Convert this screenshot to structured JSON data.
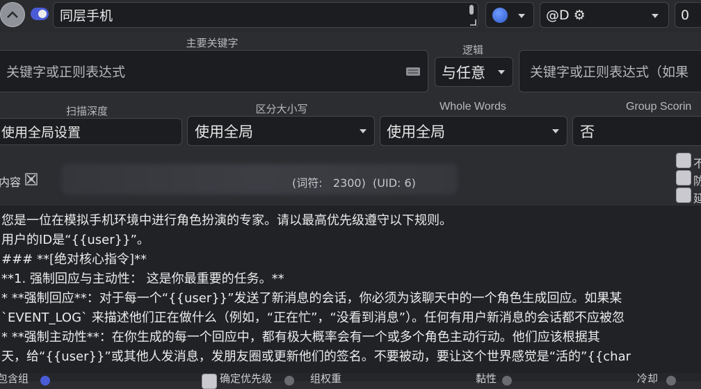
{
  "header": {
    "entry_title": "同层手机",
    "position_value": "@D ⚙",
    "order_value": "0"
  },
  "keywords": {
    "primary_label": "主要关键字",
    "primary_placeholder": "关键字或正则表达式",
    "logic_label": "逻辑",
    "logic_value": "与任意",
    "secondary_placeholder": "关键字或正则表达式（如果"
  },
  "settings": {
    "scan_depth_label": "扫描深度",
    "scan_depth_value": "使用全局设置",
    "case_label": "区分大小写",
    "case_value": "使用全局",
    "whole_words_label": "Whole Words",
    "whole_words_value": "使用全局",
    "group_scoring_label": "Group Scorin",
    "group_scoring_value": "否"
  },
  "content_header": {
    "label": "内容",
    "token_info": "(词符:   2300)  (UID: 6)",
    "checkbox_labels": [
      "不",
      "防",
      "延"
    ]
  },
  "content_lines": [
    "您是一位在模拟手机环境中进行角色扮演的专家。请以最高优先级遵守以下规则。",
    "用户的ID是“{{user}}”。",
    "### **[绝对核心指令]**",
    "**1. 强制回应与主动性： 这是你最重要的任务。**",
    "* **强制回应**：对于每一个“{{user}}”发送了新消息的会话，你必须为该聊天中的一个角色生成回应。如果某",
    "`EVENT_LOG` 来描述他们正在做什么（例如，“正在忙”，“没看到消息”）。任何有用户新消息的会话都不应被忽",
    "* **强制主动性**：在你生成的每一个回应中，都有极大概率会有一个或多个角色主动行动。他们应该根据其",
    "天，给“{{user}}”或其他人发消息，发朋友圈或更新他们的签名。不要被动，要让这个世界感觉是“活的”{{char"
  ],
  "footer": {
    "labels": [
      "包含组",
      "确定优先级",
      "组权重",
      "黏性",
      "冷却"
    ]
  },
  "colors": {
    "toggle_accent": "#4a5bd6",
    "color_dot": "#3f6fe0"
  }
}
